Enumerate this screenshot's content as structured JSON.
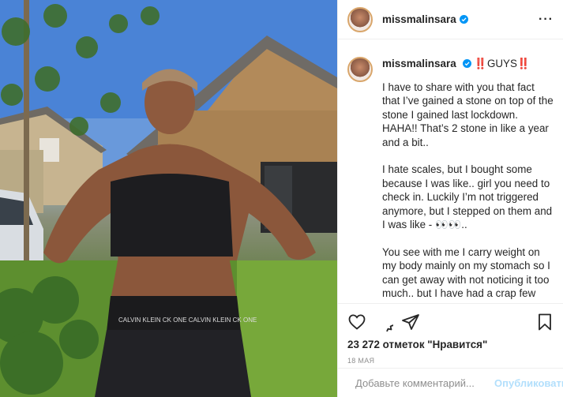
{
  "post": {
    "username": "missmalinsara",
    "verified": true,
    "more_icon": "more-horizontal-icon",
    "caption_first": "‼️GUYS‼️",
    "caption_paragraphs": [
      "I have to share with you that fact that I’ve gained a stone on top of the stone I gained last lockdown. HAHA!! That’s 2 stone in like a year and a bit..",
      "I hate scales, but I bought some because I was like.. girl you need to check in. Luckily I’m not triggered anymore, but I stepped on them and I was like - 👀👀..",
      "You see with me I carry weight on my body mainly on my stomach so I can get away with not noticing it too much.. but I have had a crap few months and started to feel sluggish, lazy and definitely not as clear in my mind."
    ],
    "likes": "23 272 отметок \"Нравится\"",
    "date": "18 мая"
  },
  "actions": {
    "icons": [
      "heart-icon",
      "comment-icon",
      "share-icon",
      "bookmark-icon"
    ]
  },
  "comment": {
    "placeholder": "Добавьте комментарий...",
    "publish_label": "Опубликовать"
  },
  "photo": {
    "waistband_text": "CALVIN KLEIN  CK ONE  CALVIN KLEIN  CK ONE"
  },
  "colors": {
    "verified": "#0095f6",
    "publish_disabled": "#b2dffc",
    "secondary_text": "#8e8e8e"
  }
}
